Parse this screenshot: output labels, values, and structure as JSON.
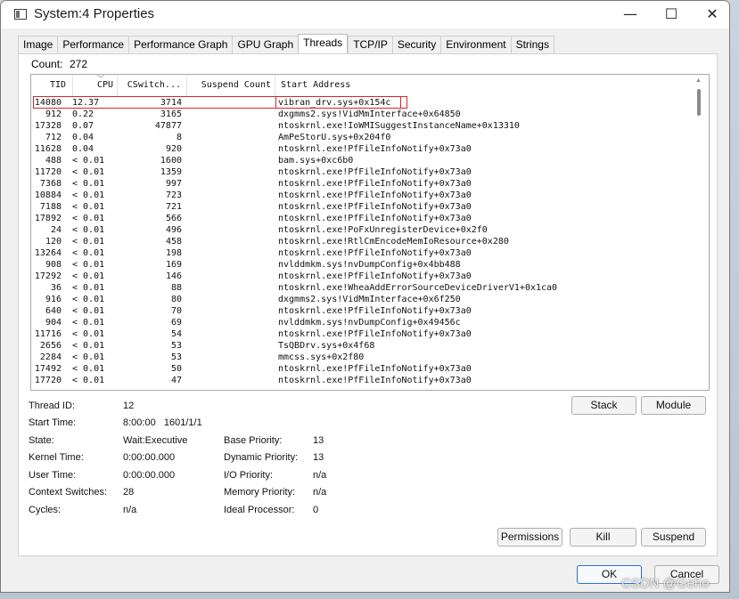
{
  "window": {
    "title": "System:4 Properties"
  },
  "caption": {
    "minimize": "—",
    "maximize": "☐",
    "close": "✕"
  },
  "tabs": [
    "Image",
    "Performance",
    "Performance Graph",
    "GPU Graph",
    "Threads",
    "TCP/IP",
    "Security",
    "Environment",
    "Strings"
  ],
  "active_tab": "Threads",
  "count": {
    "label": "Count:",
    "value": "272"
  },
  "columns": {
    "tid": "TID",
    "cpu": "CPU",
    "cswitch": "CSwitch...",
    "suspend": "Suspend Count",
    "start": "Start Address"
  },
  "threads": [
    [
      "14080",
      "12.37",
      "3714",
      "vibran_drv.sys+0x154c"
    ],
    [
      "912",
      "0.22",
      "3165",
      "dxgmms2.sys!VidMmInterface+0x64850"
    ],
    [
      "17328",
      "0.07",
      "47877",
      "ntoskrnl.exe!IoWMISuggestInstanceName+0x13310"
    ],
    [
      "712",
      "0.04",
      "8",
      "AmPeStorU.sys+0x204f0"
    ],
    [
      "11628",
      "0.04",
      "920",
      "ntoskrnl.exe!PfFileInfoNotify+0x73a0"
    ],
    [
      "488",
      "< 0.01",
      "1600",
      "bam.sys+0xc6b0"
    ],
    [
      "11720",
      "< 0.01",
      "1359",
      "ntoskrnl.exe!PfFileInfoNotify+0x73a0"
    ],
    [
      "7368",
      "< 0.01",
      "997",
      "ntoskrnl.exe!PfFileInfoNotify+0x73a0"
    ],
    [
      "10884",
      "< 0.01",
      "723",
      "ntoskrnl.exe!PfFileInfoNotify+0x73a0"
    ],
    [
      "7188",
      "< 0.01",
      "721",
      "ntoskrnl.exe!PfFileInfoNotify+0x73a0"
    ],
    [
      "17892",
      "< 0.01",
      "566",
      "ntoskrnl.exe!PfFileInfoNotify+0x73a0"
    ],
    [
      "24",
      "< 0.01",
      "496",
      "ntoskrnl.exe!PoFxUnregisterDevice+0x2f0"
    ],
    [
      "120",
      "< 0.01",
      "458",
      "ntoskrnl.exe!RtlCmEncodeMemIoResource+0x280"
    ],
    [
      "13264",
      "< 0.01",
      "198",
      "ntoskrnl.exe!PfFileInfoNotify+0x73a0"
    ],
    [
      "908",
      "< 0.01",
      "169",
      "nvlddmkm.sys!nvDumpConfig+0x4bb488"
    ],
    [
      "17292",
      "< 0.01",
      "146",
      "ntoskrnl.exe!PfFileInfoNotify+0x73a0"
    ],
    [
      "36",
      "< 0.01",
      "88",
      "ntoskrnl.exe!WheaAddErrorSourceDeviceDriverV1+0x1ca0"
    ],
    [
      "916",
      "< 0.01",
      "80",
      "dxgmms2.sys!VidMmInterface+0x6f250"
    ],
    [
      "640",
      "< 0.01",
      "70",
      "ntoskrnl.exe!PfFileInfoNotify+0x73a0"
    ],
    [
      "904",
      "< 0.01",
      "69",
      "nvlddmkm.sys!nvDumpConfig+0x49456c"
    ],
    [
      "11716",
      "< 0.01",
      "54",
      "ntoskrnl.exe!PfFileInfoNotify+0x73a0"
    ],
    [
      "2656",
      "< 0.01",
      "53",
      "TsQBDrv.sys+0x4f68"
    ],
    [
      "2284",
      "< 0.01",
      "53",
      "mmcss.sys+0x2f80"
    ],
    [
      "17492",
      "< 0.01",
      "50",
      "ntoskrnl.exe!PfFileInfoNotify+0x73a0"
    ],
    [
      "17720",
      "< 0.01",
      "47",
      "ntoskrnl.exe!PfFileInfoNotify+0x73a0"
    ]
  ],
  "details": {
    "thread_id": {
      "label": "Thread ID:",
      "value": "12"
    },
    "start_time": {
      "label": "Start Time:",
      "value": "8:00:00   1601/1/1"
    },
    "state": {
      "label": "State:",
      "value": "Wait:Executive"
    },
    "kernel_time": {
      "label": "Kernel Time:",
      "value": "0:00:00.000"
    },
    "user_time": {
      "label": "User Time:",
      "value": "0:00:00.000"
    },
    "context_switches": {
      "label": "Context Switches:",
      "value": "28"
    },
    "cycles": {
      "label": "Cycles:",
      "value": "n/a"
    },
    "base_priority": {
      "label": "Base Priority:",
      "value": "13"
    },
    "dynamic_priority": {
      "label": "Dynamic Priority:",
      "value": "13"
    },
    "io_priority": {
      "label": "I/O Priority:",
      "value": "n/a"
    },
    "memory_priority": {
      "label": "Memory Priority:",
      "value": "n/a"
    },
    "ideal_processor": {
      "label": "Ideal Processor:",
      "value": "0"
    }
  },
  "buttons": {
    "stack": "Stack",
    "module": "Module",
    "permissions": "Permissions",
    "kill": "Kill",
    "suspend": "Suspend",
    "ok": "OK",
    "cancel": "Cancel"
  },
  "watermark": "CSDN @Geho",
  "colors": {
    "highlight": "#d9252a",
    "ok_border": "#2a70d0"
  }
}
